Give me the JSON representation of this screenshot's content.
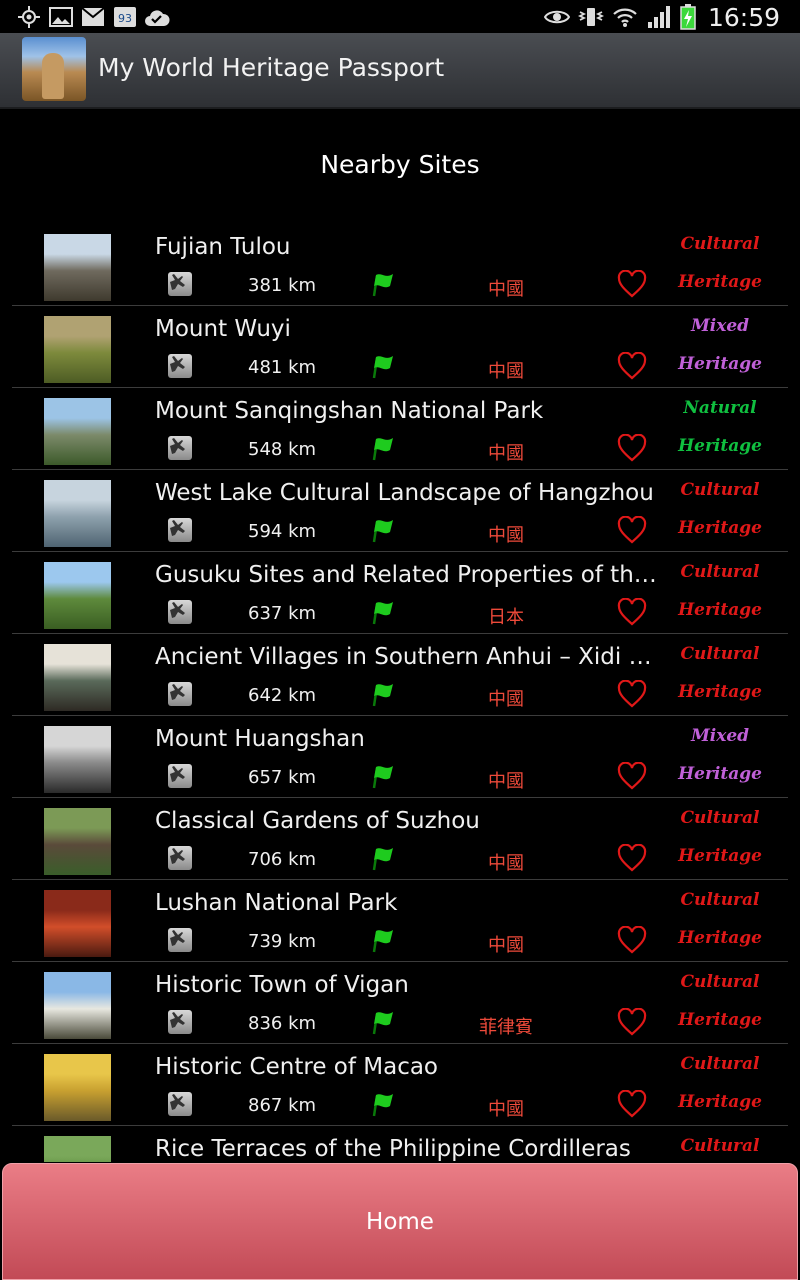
{
  "status_bar": {
    "time": "16:59",
    "notification_badge": "93",
    "left_icons": [
      "gps-icon",
      "image-icon",
      "gmail-icon",
      "calendar-badge-icon",
      "check-cloud-icon"
    ],
    "right_icons": [
      "eye-icon",
      "vibrate-icon",
      "wifi-icon",
      "signal-icon",
      "battery-charging-icon"
    ]
  },
  "app_bar": {
    "title": "My World Heritage Passport"
  },
  "section_title": "Nearby Sites",
  "colors": {
    "cultural": "#e01818",
    "mixed": "#c060d8",
    "natural": "#10c040",
    "country": "#ee4a3a",
    "home_button": "#d95f6b"
  },
  "sites": [
    {
      "name": "Fujian Tulou",
      "distance": "381 km",
      "country": "中國",
      "category": "Cultural",
      "category_line2": "Heritage",
      "cat_class": "cultural",
      "thumb_colors": [
        "#c9d8e6",
        "#6f6a5e",
        "#3f3a2e"
      ]
    },
    {
      "name": "Mount Wuyi",
      "distance": "481 km",
      "country": "中國",
      "category": "Mixed",
      "category_line2": "Heritage",
      "cat_class": "mixed",
      "thumb_colors": [
        "#b0a272",
        "#7d8a3c",
        "#4d5c24"
      ]
    },
    {
      "name": "Mount Sanqingshan National Park",
      "distance": "548 km",
      "country": "中國",
      "category": "Natural",
      "category_line2": "Heritage",
      "cat_class": "natural",
      "thumb_colors": [
        "#9cc4e6",
        "#7c8a6a",
        "#3c5a2a"
      ]
    },
    {
      "name": "West Lake Cultural Landscape of Hangzhou",
      "distance": "594 km",
      "country": "中國",
      "category": "Cultural",
      "category_line2": "Heritage",
      "cat_class": "cultural",
      "thumb_colors": [
        "#c7d4de",
        "#8ea1ad",
        "#4f6472"
      ]
    },
    {
      "name": "Gusuku Sites and Related Properties of the K…",
      "distance": "637 km",
      "country": "日本",
      "category": "Cultural",
      "category_line2": "Heritage",
      "cat_class": "cultural",
      "thumb_colors": [
        "#9cc8ee",
        "#5e8a3c",
        "#3a5e22"
      ]
    },
    {
      "name": "Ancient Villages in Southern Anhui – Xidi an…",
      "distance": "642 km",
      "country": "中國",
      "category": "Cultural",
      "category_line2": "Heritage",
      "cat_class": "cultural",
      "thumb_colors": [
        "#e6e2d8",
        "#5a6a5a",
        "#2e2a24"
      ]
    },
    {
      "name": "Mount Huangshan",
      "distance": "657 km",
      "country": "中國",
      "category": "Mixed",
      "category_line2": "Heritage",
      "cat_class": "mixed",
      "thumb_colors": [
        "#d6d6d6",
        "#8a8a8a",
        "#2a2a2a"
      ]
    },
    {
      "name": "Classical Gardens of Suzhou",
      "distance": "706 km",
      "country": "中國",
      "category": "Cultural",
      "category_line2": "Heritage",
      "cat_class": "cultural",
      "thumb_colors": [
        "#7c9a56",
        "#5a4a3a",
        "#3a5e2a"
      ]
    },
    {
      "name": "Lushan National Park",
      "distance": "739 km",
      "country": "中國",
      "category": "Cultural",
      "category_line2": "Heritage",
      "cat_class": "cultural",
      "thumb_colors": [
        "#8a2a1a",
        "#d24e2a",
        "#4a1a10"
      ]
    },
    {
      "name": "Historic Town of Vigan",
      "distance": "836 km",
      "country": "菲律賓",
      "category": "Cultural",
      "category_line2": "Heritage",
      "cat_class": "cultural",
      "thumb_colors": [
        "#8ab8e6",
        "#e8e8e0",
        "#4a4a3a"
      ]
    },
    {
      "name": "Historic Centre of Macao",
      "distance": "867 km",
      "country": "中國",
      "category": "Cultural",
      "category_line2": "Heritage",
      "cat_class": "cultural",
      "thumb_colors": [
        "#e8c64a",
        "#c8a030",
        "#6a5a2a"
      ]
    },
    {
      "name": "Rice Terraces of the Philippine Cordilleras",
      "distance": "",
      "country": "",
      "category": "Cultural",
      "category_line2": "",
      "cat_class": "cultural",
      "thumb_colors": [
        "#7aa85a",
        "#5a8a3a",
        "#3a5a2a"
      ]
    }
  ],
  "home_button": {
    "label": "Home"
  }
}
